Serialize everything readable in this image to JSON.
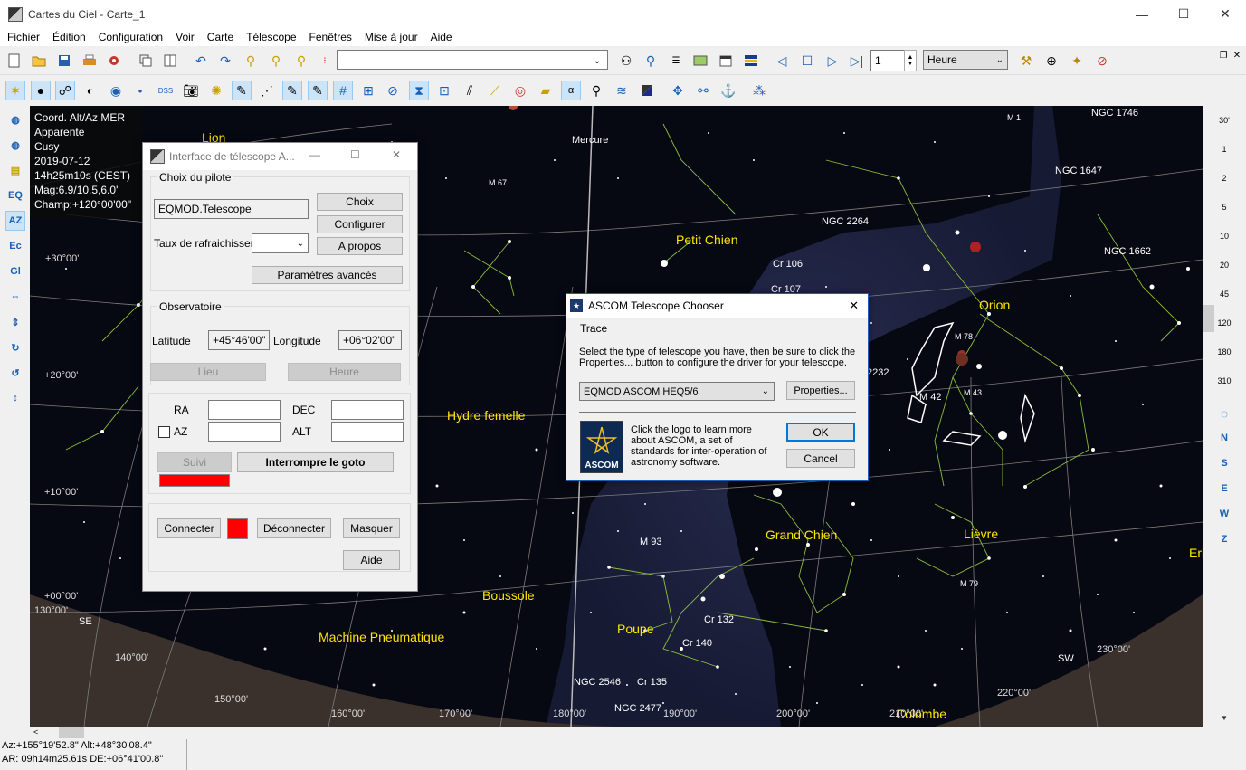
{
  "window": {
    "title": "Cartes du Ciel - Carte_1",
    "minimize": "—",
    "maximize": "☐",
    "close": "✕"
  },
  "menu": [
    "Fichier",
    "Édition",
    "Configuration",
    "Voir",
    "Carte",
    "Télescope",
    "Fenêtres",
    "Mise à jour",
    "Aide"
  ],
  "toolbar": {
    "search_value": "",
    "step_value": "1",
    "unit_value": "Heure"
  },
  "info_panel": {
    "lines": [
      "Coord. Alt/Az MER",
      "Apparente",
      "Cusy",
      "2019-07-12",
      "14h25m10s (CEST)",
      "Mag:6.9/10.5,6.0'",
      "Champ:+120°00'00\""
    ]
  },
  "left_toolbar": {
    "eq": "EQ",
    "az": "AZ",
    "ec": "Ec",
    "gl": "Gl"
  },
  "zoom_levels": [
    "30'",
    "1",
    "2",
    "5",
    "10",
    "20",
    "45",
    "120",
    "180",
    "310"
  ],
  "compass": [
    "N",
    "S",
    "E",
    "W",
    "Z"
  ],
  "sky": {
    "constellations": [
      "Lion",
      "Petit Chien",
      "Orion",
      "Hydre femelle",
      "Grand Chien",
      "Lièvre",
      "Boussole",
      "Poupe",
      "Machine Pneumatique",
      "Colombe",
      "Eri"
    ],
    "objects": [
      "Mercure",
      "NGC 1746",
      "M 1",
      "NGC 1647",
      "NGC 2264",
      "NGC 1662",
      "Cr 106",
      "Cr 107",
      "M 67",
      "M 78",
      "M 42",
      "M 43",
      "M 93",
      "M 79",
      "Cr 132",
      "Cr 140",
      "NGC 2546",
      "Cr 135",
      "NGC 2477",
      "2232"
    ],
    "grid": [
      "+30°00'",
      "+20°00'",
      "+10°00'",
      "+00°00'",
      "130°00'",
      "140°00'",
      "150°00'",
      "160°00'",
      "170°00'",
      "180°00'",
      "190°00'",
      "200°00'",
      "210°00'",
      "220°00'",
      "230°00'"
    ],
    "horizon": [
      "SE",
      "SW"
    ]
  },
  "telescope_dialog": {
    "title": "Interface de télescope A...",
    "pilot_group": "Choix du pilote",
    "driver": "EQMOD.Telescope",
    "choose": "Choix",
    "configure": "Configurer",
    "about": "A propos",
    "refresh_label": "Taux de rafraichissen",
    "advanced": "Paramètres avancés",
    "observatory_group": "Observatoire",
    "latitude_label": "Latitude",
    "latitude": "+45°46'00\"",
    "longitude_label": "Longitude",
    "longitude": "+06°02'00\"",
    "place": "Lieu",
    "time": "Heure",
    "ra": "RA",
    "dec": "DEC",
    "az": "AZ",
    "alt": "ALT",
    "track": "Suivi",
    "abort": "Interrompre le goto",
    "connect": "Connecter",
    "disconnect": "Déconnecter",
    "hide": "Masquer",
    "help": "Aide"
  },
  "ascom_dialog": {
    "title": "ASCOM Telescope Chooser",
    "trace": "Trace",
    "instruction": "Select the type of telescope you have, then be sure to click the Properties... button to configure the driver for your telescope.",
    "selected": "EQMOD ASCOM HEQ5/6",
    "properties": "Properties...",
    "logo_text": "ASCOM",
    "about_text": "Click the logo to learn more about ASCOM, a set of standards for inter-operation of astronomy software.",
    "ok": "OK",
    "cancel": "Cancel"
  },
  "statusbar": {
    "line1": "Az:+155°19'52.8\" Alt:+48°30'08.4\"",
    "line2": "AR: 09h14m25.61s DE:+06°41'00.8\""
  },
  "colors": {
    "sky": "#060812",
    "milkyway": "#1f2340",
    "label": "#ffe500",
    "grid": "#8a8a8a",
    "constellation": "#8cbf3c",
    "ground": "#3a302c",
    "accent": "#1a5fb4"
  }
}
